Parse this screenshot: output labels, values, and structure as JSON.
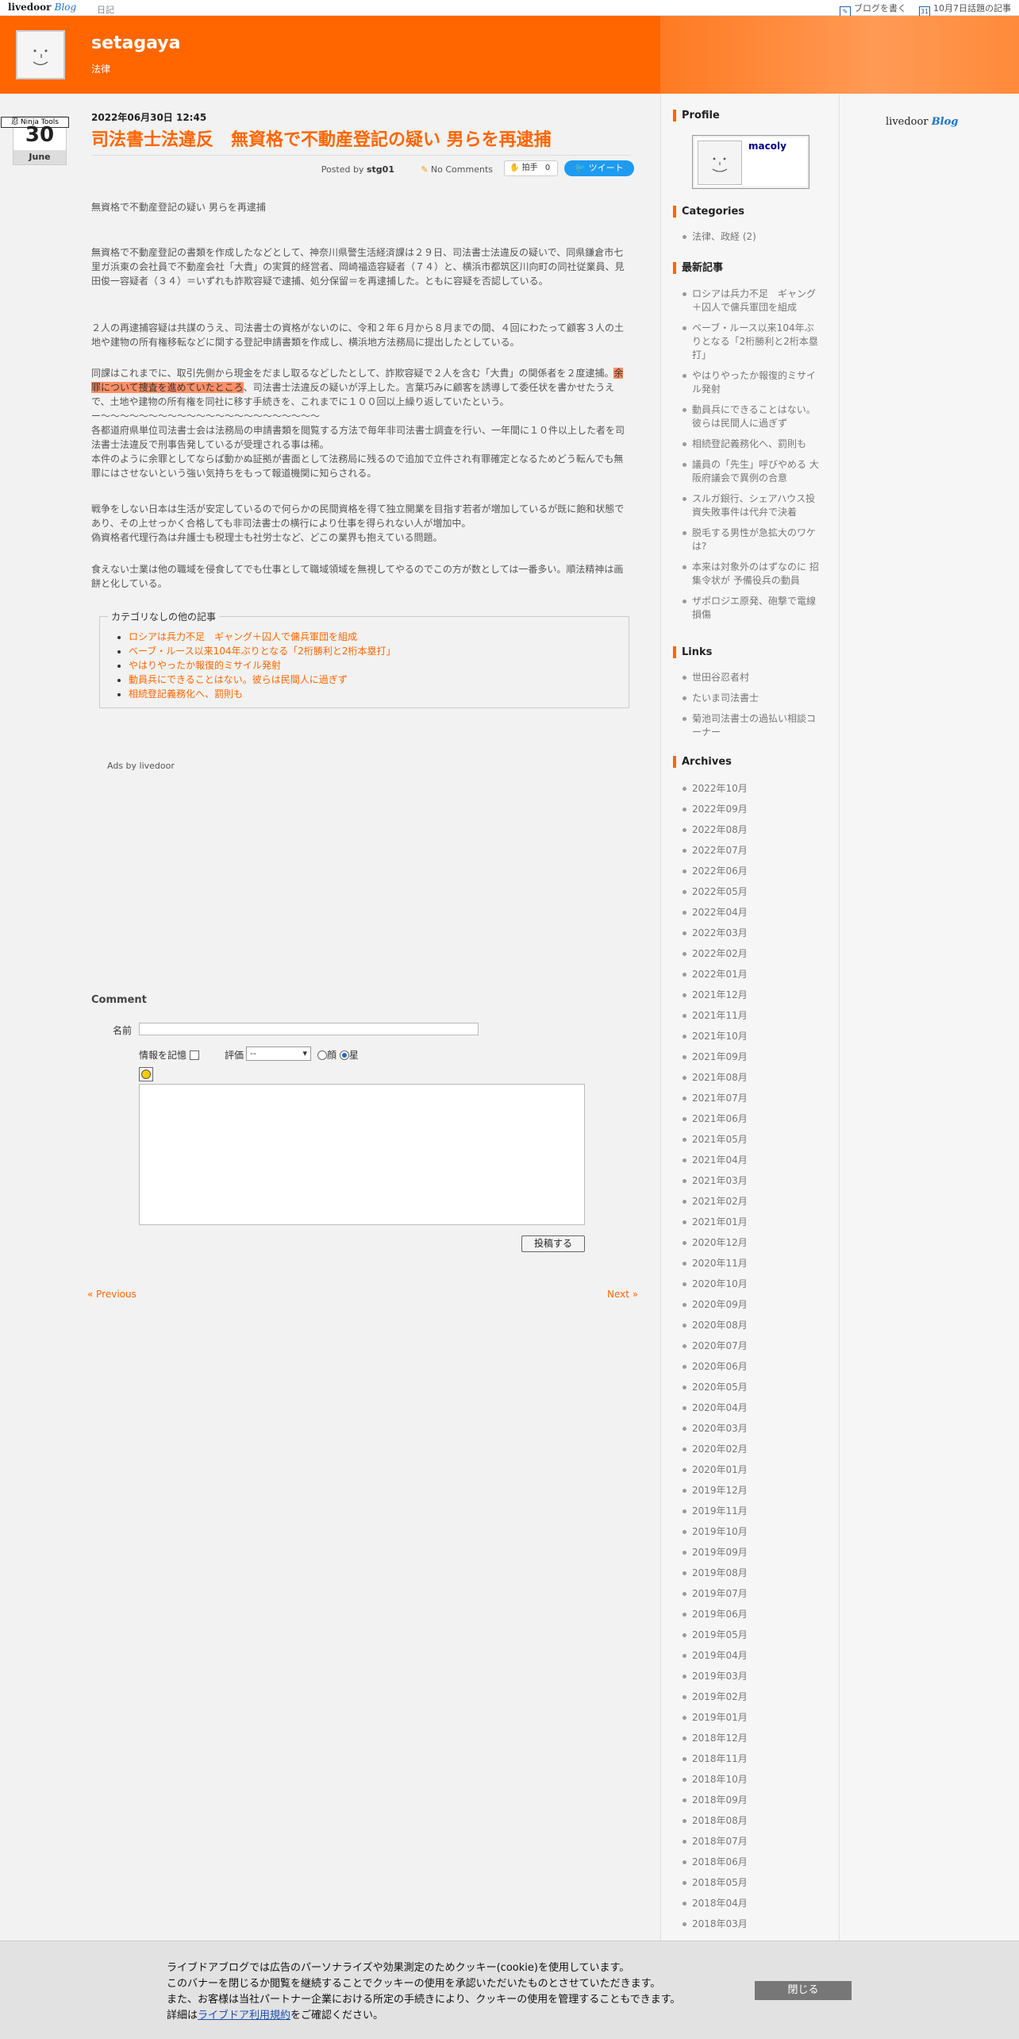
{
  "topbar": {
    "logo_main": "livedoor",
    "logo_blog": "Blog",
    "diary": "日記",
    "write_blog": "ブログを書く",
    "trending": "10月7日話題の記事",
    "calendar_icon_num": "31"
  },
  "header": {
    "title": "setagaya",
    "subtitle": "法律"
  },
  "datebadge": {
    "ninja": "忍 Ninja Tools",
    "day": "30",
    "month": "June"
  },
  "post": {
    "date": "2022年06月30日 12:45",
    "title": "司法書士法違反　無資格で不動産登記の疑い 男らを再逮捕",
    "posted_by_label": "Posted by",
    "author": "stg01",
    "comments": "No Comments",
    "clap_label": "拍手",
    "clap_count": "0",
    "tweet": "ツイート",
    "lead": "無資格で不動産登記の疑い 男らを再逮捕",
    "p1": "無資格で不動産登記の書類を作成したなどとして、神奈川県警生活経済課は２９日、司法書士法違反の疑いで、同県鎌倉市七里ガ浜東の会社員で不動産会社「大貴」の実質的経営者、岡崎福造容疑者（７４）と、横浜市都筑区川向町の同社従業員、見田俊一容疑者（３４）＝いずれも詐欺容疑で逮捕、処分保留＝を再逮捕した。ともに容疑を否認している。",
    "p2": "２人の再逮捕容疑は共謀のうえ、司法書士の資格がないのに、令和２年６月から８月までの間、４回にわたって顧客３人の土地や建物の所有権移転などに関する登記申請書類を作成し、横浜地方法務局に提出したとしている。",
    "p3_a": "同課はこれまでに、取引先側から現金をだまし取るなどしたとして、詐欺容疑で２人を含む「大貴」の関係者を２度逮捕。",
    "p3_hl": "余罪について捜査を進めていたところ",
    "p3_b": "、司法書士法違反の疑いが浮上した。言葉巧みに顧客を誘導して委任状を書かせたうえで、土地や建物の所有権を同社に移す手続きを、これまでに１００回以上繰り返していたという。",
    "p3_dash": "ー～～～～～～～～～～～～～～～～～～～～～～～",
    "p3_c": "各都道府県単位司法書士会は法務局の申請書類を閲覧する方法で毎年非司法書士調査を行い、一年間に１０件以上した者を司法書士法違反で刑事告発しているが受理される事は稀。",
    "p3_d": "本件のように余罪としてならば動かぬ証拠が書面として法務局に残るので追加で立件され有罪確定となるためどう転んでも無罪にはさせないという強い気持ちをもって報道機関に知らされる。",
    "p4_a": "戦争をしない日本は生活が安定しているので何らかの民間資格を得て独立開業を目指す若者が増加しているが既に飽和状態であり、その上せっかく合格しても非司法書士の横行により仕事を得られない人が増加中。",
    "p4_b": "偽資格者代理行為は弁護士も税理士も社労士など、どこの業界も抱えている問題。",
    "p5": "食えない士業は他の職域を侵食してでも仕事として職域領域を無視してやるのでこの方が数としては一番多い。順法精神は画餅と化している。"
  },
  "related": {
    "legend": "カテゴリなしの他の記事",
    "items": [
      "ロシアは兵力不足　ギャング＋囚人で傭兵軍団を組成",
      "ベーブ・ルース以来104年ぶりとなる「2桁勝利と2桁本塁打」",
      "やはりやったか報復的ミサイル発射",
      "動員兵にできることはない。彼らは民間人に過ぎず",
      "相続登記義務化へ、罰則も"
    ]
  },
  "ads": "Ads by livedoor",
  "comment": {
    "heading": "Comment",
    "name_label": "名前",
    "remember_label": "情報を記憶",
    "rating_label": "評価",
    "rating_value": "--",
    "radio_face": "顔",
    "radio_star": "星",
    "submit": "投稿する"
  },
  "nav": {
    "prev": "« Previous",
    "next": "Next »"
  },
  "sidebar": {
    "profile_heading": "Profile",
    "profile_name": "macoly",
    "categories_heading": "Categories",
    "categories": [
      "法律、政経 (2)"
    ],
    "recent_heading": "最新記事",
    "recent": [
      "ロシアは兵力不足　ギャング＋囚人で傭兵軍団を組成",
      "ベーブ・ルース以来104年ぶりとなる「2桁勝利と2桁本塁打」",
      "やはりやったか報復的ミサイル発射",
      "動員兵にできることはない。彼らは民間人に過ぎず",
      "相続登記義務化へ、罰則も",
      "議員の「先生」呼びやめる 大阪府議会で異例の合意",
      "スルガ銀行、シェアハウス投資失敗事件は代弁で決着",
      "脱毛する男性が急拡大のワケは?",
      "本来は対象外のはずなのに 招集令状が 予備役兵の動員",
      "ザポロジエ原発、砲撃で電線損傷"
    ],
    "links_heading": "Links",
    "links": [
      "世田谷忍者村",
      "たいま司法書士",
      "菊池司法書士の過払い相談コーナー"
    ],
    "archives_heading": "Archives",
    "archives": [
      "2022年10月",
      "2022年09月",
      "2022年08月",
      "2022年07月",
      "2022年06月",
      "2022年05月",
      "2022年04月",
      "2022年03月",
      "2022年02月",
      "2022年01月",
      "2021年12月",
      "2021年11月",
      "2021年10月",
      "2021年09月",
      "2021年08月",
      "2021年07月",
      "2021年06月",
      "2021年05月",
      "2021年04月",
      "2021年03月",
      "2021年02月",
      "2021年01月",
      "2020年12月",
      "2020年11月",
      "2020年10月",
      "2020年09月",
      "2020年08月",
      "2020年07月",
      "2020年06月",
      "2020年05月",
      "2020年04月",
      "2020年03月",
      "2020年02月",
      "2020年01月",
      "2019年12月",
      "2019年11月",
      "2019年10月",
      "2019年09月",
      "2019年08月",
      "2019年07月",
      "2019年06月",
      "2019年05月",
      "2019年04月",
      "2019年03月",
      "2019年02月",
      "2019年01月",
      "2018年12月",
      "2018年11月",
      "2018年10月",
      "2018年09月",
      "2018年08月",
      "2018年07月",
      "2018年06月",
      "2018年05月",
      "2018年04月",
      "2018年03月"
    ],
    "lblogo_main": "livedoor",
    "lblogo_blog": "Blog"
  },
  "cookie": {
    "line1": "ライブドアブログでは広告のパーソナライズや効果測定のためクッキー(cookie)を使用しています。",
    "line2": "このバナーを閉じるか閲覧を継続することでクッキーの使用を承認いただいたものとさせていただきます。",
    "line3": "また、お客様は当社パートナー企業における所定の手続きにより、クッキーの使用を管理することもできます。",
    "line4_a": "詳細は",
    "line4_link": "ライブドア利用規約",
    "line4_b": "をご確認ください。",
    "close": "閉じる"
  },
  "colors": {
    "accent": "#ff6600",
    "tweet": "#1d9bf0"
  }
}
